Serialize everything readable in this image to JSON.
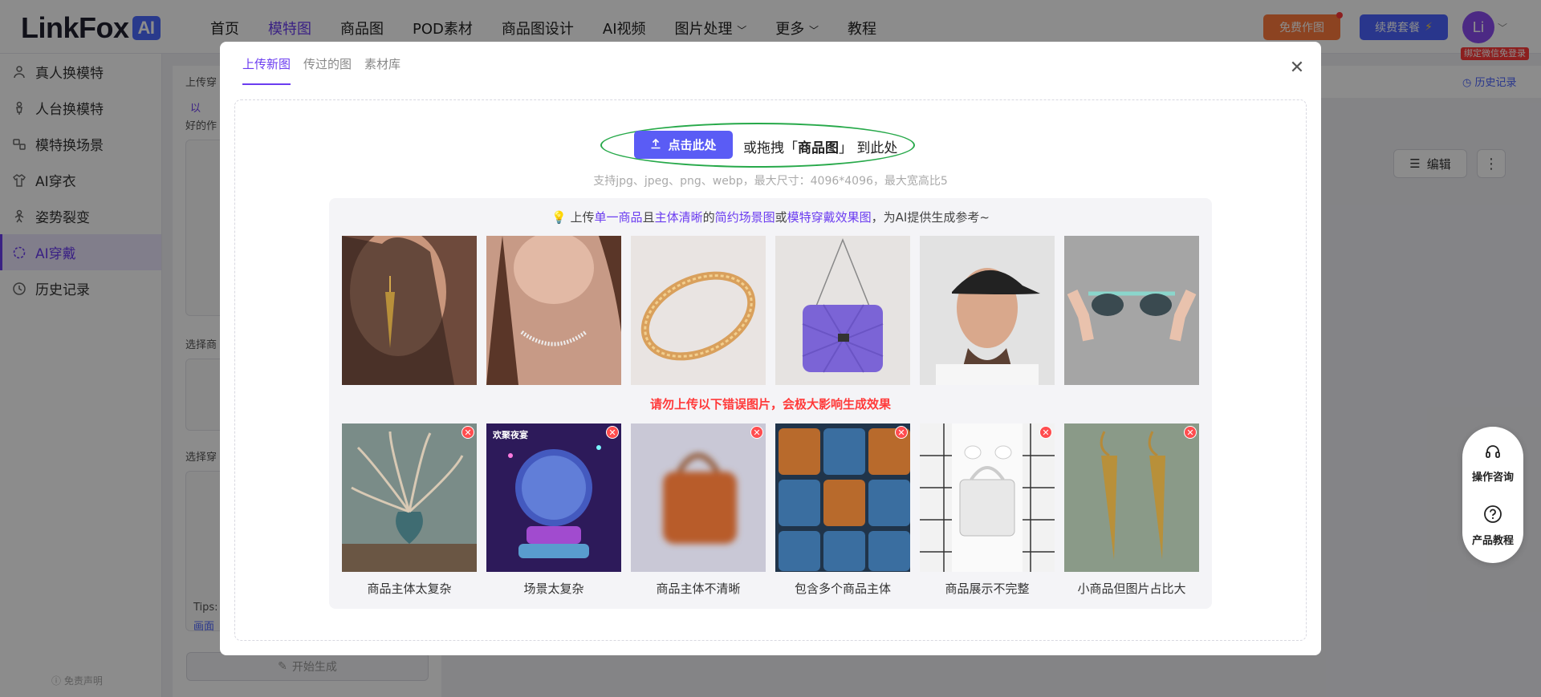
{
  "logo": {
    "text": "LinkFox",
    "badge": "AI"
  },
  "nav": [
    "首页",
    "模特图",
    "商品图",
    "POD素材",
    "商品图设计",
    "AI视频",
    "图片处理",
    "更多",
    "教程"
  ],
  "nav_active_index": 1,
  "header": {
    "free_button": "免费作图",
    "renew_button": "续费套餐",
    "avatar_text": "Li",
    "bind_tag": "绑定微信免登录"
  },
  "sidebar": {
    "items": [
      {
        "label": "真人换模特",
        "icon": "person-swap-icon"
      },
      {
        "label": "人台换模特",
        "icon": "mannequin-icon"
      },
      {
        "label": "模特换场景",
        "icon": "scene-icon"
      },
      {
        "label": "AI穿衣",
        "icon": "shirt-icon"
      },
      {
        "label": "姿势裂变",
        "icon": "pose-icon"
      },
      {
        "label": "AI穿戴",
        "icon": "loader-icon"
      },
      {
        "label": "历史记录",
        "icon": "history-icon"
      }
    ],
    "active_index": 5,
    "disclaimer": "免责声明"
  },
  "background_panel": {
    "upload_label": "上传穿",
    "hint1": "以",
    "hint2": "好的作",
    "select_product": "选择商",
    "select_wear": "选择穿",
    "tips": "Tips:",
    "canvas": "画面",
    "start_button": "开始生成",
    "history_link": "历史记录",
    "edit_button": "编辑"
  },
  "modal": {
    "tabs": [
      "上传新图",
      "传过的图",
      "素材库"
    ],
    "active_tab": 0,
    "upload_button": "点击此处",
    "drag_prefix": "或拖拽「",
    "drag_bold": "商品图",
    "drag_suffix": "」 到此处",
    "support": "支持jpg、jpeg、png、webp，最大尺寸：4096*4096，最大宽高比5",
    "tip_parts": [
      "上传",
      "单一商品",
      "且",
      "主体清晰",
      "的",
      "简约场景图",
      "或",
      "模特穿戴效果图",
      "，为AI提供生成参考~"
    ],
    "warning": "请勿上传以下错误图片，会极大影响生成效果",
    "good_examples": [
      "earring-on-model",
      "necklace-on-model",
      "gold-bracelet",
      "purple-handbag",
      "black-cap-on-model",
      "sunglasses-in-hands"
    ],
    "bad_examples": [
      {
        "image": "pampas-grass-vase",
        "caption": "商品主体太复杂"
      },
      {
        "image": "neon-crystal-ball",
        "caption": "场景太复杂",
        "overlay_text": "欢聚夜宴"
      },
      {
        "image": "blurry-orange-bag",
        "caption": "商品主体不清晰"
      },
      {
        "image": "many-bags-grid",
        "caption": "包含多个商品主体"
      },
      {
        "image": "cropped-white-bag",
        "caption": "商品展示不完整"
      },
      {
        "image": "earrings-on-cloth",
        "caption": "小商品但图片占比大"
      }
    ]
  },
  "float_help": [
    {
      "label": "操作咨询",
      "icon": "headset-icon"
    },
    {
      "label": "产品教程",
      "icon": "question-icon"
    }
  ],
  "colors": {
    "accent": "#6b3cf0",
    "upload": "#5a5cf5",
    "warning": "#ff3a3a",
    "ring": "#27a94a"
  }
}
